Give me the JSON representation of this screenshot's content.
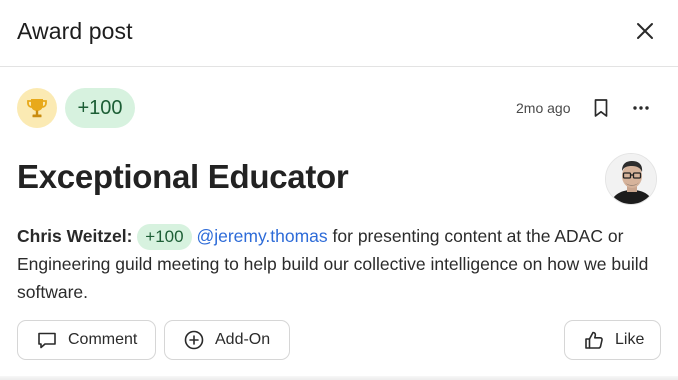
{
  "header": {
    "title": "Award post"
  },
  "post": {
    "points": "+100",
    "timestamp": "2mo ago",
    "title": "Exceptional Educator",
    "author": "Chris Weitzel:",
    "inline_points": "+100",
    "mention": "@jeremy.thomas",
    "message": " for presenting content at the ADAC or Engineering guild meeting to help build our collective intelligence on how we build software."
  },
  "actions": {
    "comment_label": "Comment",
    "addon_label": "Add-On",
    "like_label": "Like"
  },
  "colors": {
    "badge_bg": "#d7f2df",
    "badge_text": "#1c5e35",
    "mention": "#2d6bd8",
    "trophy_bg": "#fbeab3",
    "trophy": "#e8a91a"
  }
}
